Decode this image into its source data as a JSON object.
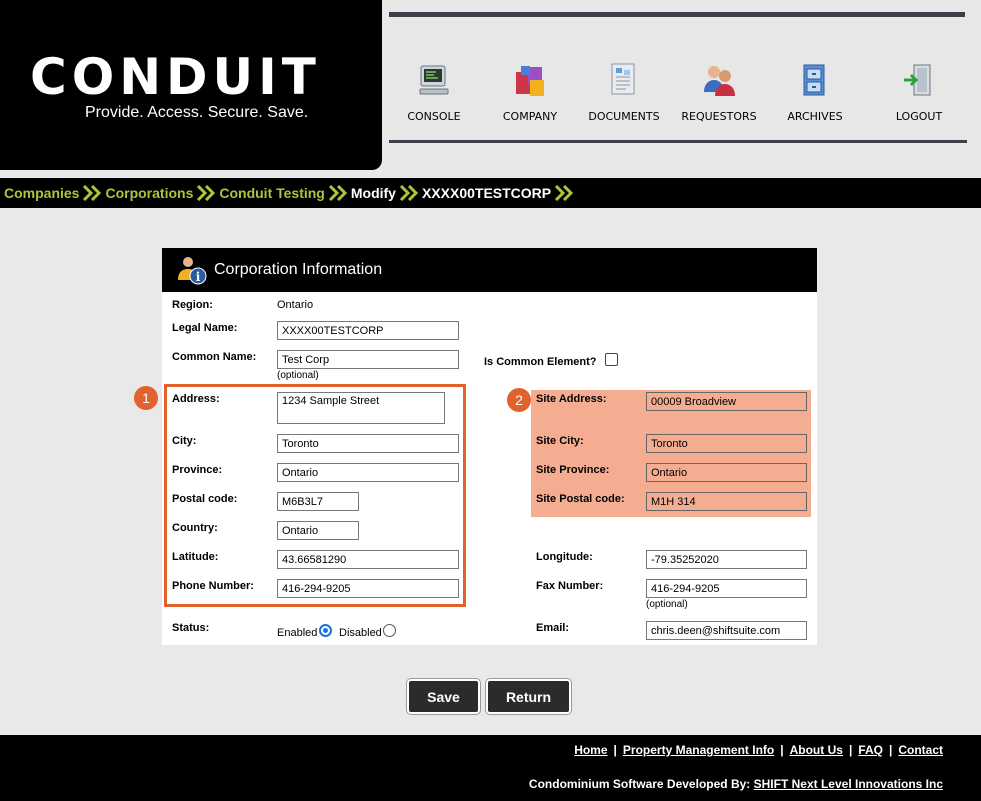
{
  "brand": {
    "logo": "CONDUIT",
    "tagline": "Provide. Access. Secure. Save."
  },
  "nav": [
    {
      "label": "CONSOLE",
      "icon": "console-icon"
    },
    {
      "label": "COMPANY",
      "icon": "company-icon"
    },
    {
      "label": "DOCUMENTS",
      "icon": "documents-icon"
    },
    {
      "label": "REQUESTORS",
      "icon": "requestors-icon"
    },
    {
      "label": "ARCHIVES",
      "icon": "archives-icon"
    },
    {
      "label": "LOGOUT",
      "icon": "logout-icon"
    }
  ],
  "breadcrumb": [
    "Companies",
    "Corporations",
    "Conduit Testing",
    "Modify",
    "XXXX00TESTCORP"
  ],
  "panel": {
    "title": "Corporation Information",
    "region_label": "Region:",
    "region_value": "Ontario",
    "legal_name_label": "Legal Name:",
    "legal_name_value": "XXXX00TESTCORP",
    "common_name_label": "Common Name:",
    "common_name_value": "Test Corp",
    "common_name_hint": "(optional)",
    "common_element_label": "Is Common Element?",
    "address_label": "Address:",
    "address_value": "1234 Sample Street",
    "city_label": "City:",
    "city_value": "Toronto",
    "province_label": "Province:",
    "province_value": "Ontario",
    "postal_label": "Postal code:",
    "postal_value": "M6B3L7",
    "country_label": "Country:",
    "country_value": "Ontario",
    "latitude_label": "Latitude:",
    "latitude_value": "43.66581290",
    "phone_label": "Phone Number:",
    "phone_value": "416-294-9205",
    "status_label": "Status:",
    "enabled_label": "Enabled",
    "disabled_label": "Disabled",
    "site_address_label": "Site Address:",
    "site_address_value": "00009 Broadview",
    "site_city_label": "Site City:",
    "site_city_value": "Toronto",
    "site_province_label": "Site Province:",
    "site_province_value": "Ontario",
    "site_postal_label": "Site Postal code:",
    "site_postal_value": "M1H 314",
    "longitude_label": "Longitude:",
    "longitude_value": "-79.35252020",
    "fax_label": "Fax Number:",
    "fax_value": "416-294-9205",
    "fax_hint": "(optional)",
    "email_label": "Email:",
    "email_value": "chris.deen@shiftsuite.com"
  },
  "annotations": {
    "badge1": "1",
    "badge2": "2"
  },
  "buttons": {
    "save": "Save",
    "return": "Return"
  },
  "footer": {
    "links": [
      "Home",
      "Property Management Info",
      "About Us",
      "FAQ",
      "Contact"
    ],
    "dev_prefix": "Condominium Software Developed By:",
    "dev_link": "SHIFT Next Level Innovations Inc"
  },
  "colors": {
    "accent": "#a8c63a",
    "highlight": "#e0622c",
    "highlight_fill": "#f5ad92"
  }
}
